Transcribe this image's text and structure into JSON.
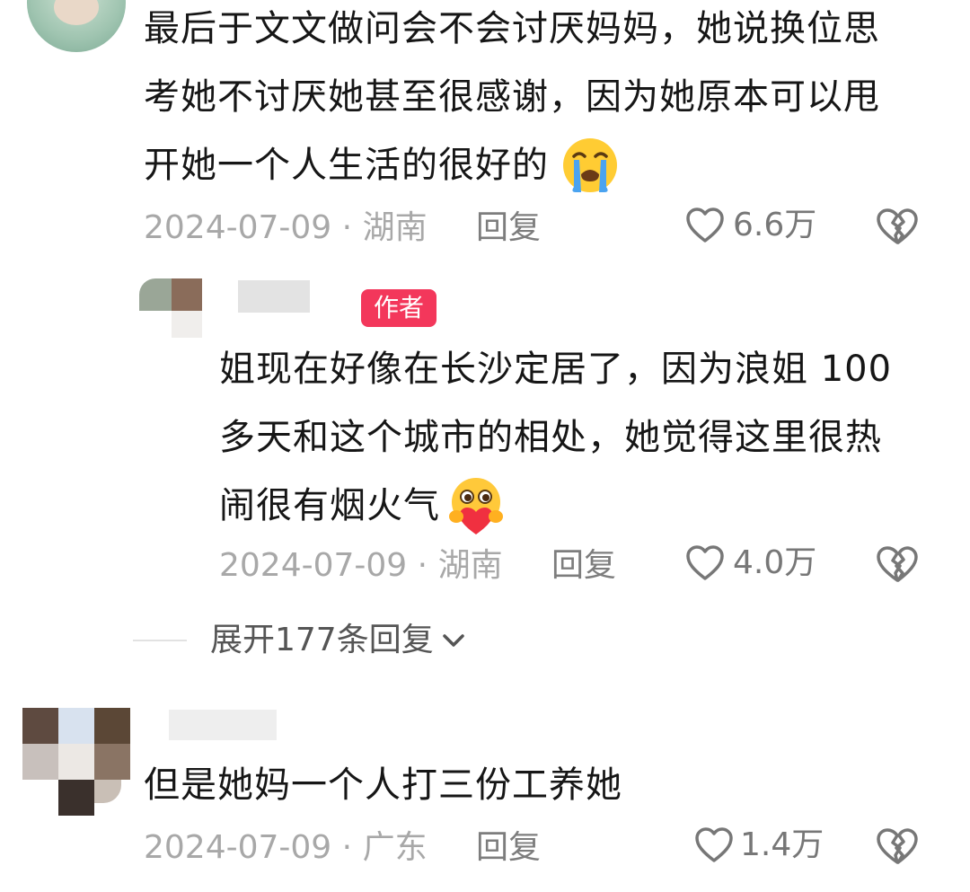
{
  "comments": [
    {
      "text_lines": [
        "最后于文文做问会不会讨厌妈妈，她说换位思",
        "考她不讨厌她甚至很感谢，因为她原本可以甩",
        "开她一个人生活的很好的"
      ],
      "emoji_icon": "loudly-crying-face",
      "date": "2024-07-09",
      "location": "湖南",
      "reply_label": "回复",
      "likes": "6.6万"
    },
    {
      "author_badge": "作者",
      "text_lines": [
        "姐现在好像在长沙定居了，因为浪姐 100",
        "多天和这个城市的相处，她觉得这里很热",
        "闹很有烟火气"
      ],
      "emoji_icon": "hugging-heart-face",
      "date": "2024-07-09",
      "location": "湖南",
      "reply_label": "回复",
      "likes": "4.0万"
    },
    {
      "text_lines": [
        "但是她妈一个人打三份工养她"
      ],
      "date": "2024-07-09",
      "location": "广东",
      "reply_label": "回复",
      "likes": "1.4万"
    }
  ],
  "expand_replies_label": "展开177条回复",
  "colors": {
    "author_badge_bg": "#f3375b",
    "meta_gray": "#a8a8a8",
    "text": "#161616"
  }
}
